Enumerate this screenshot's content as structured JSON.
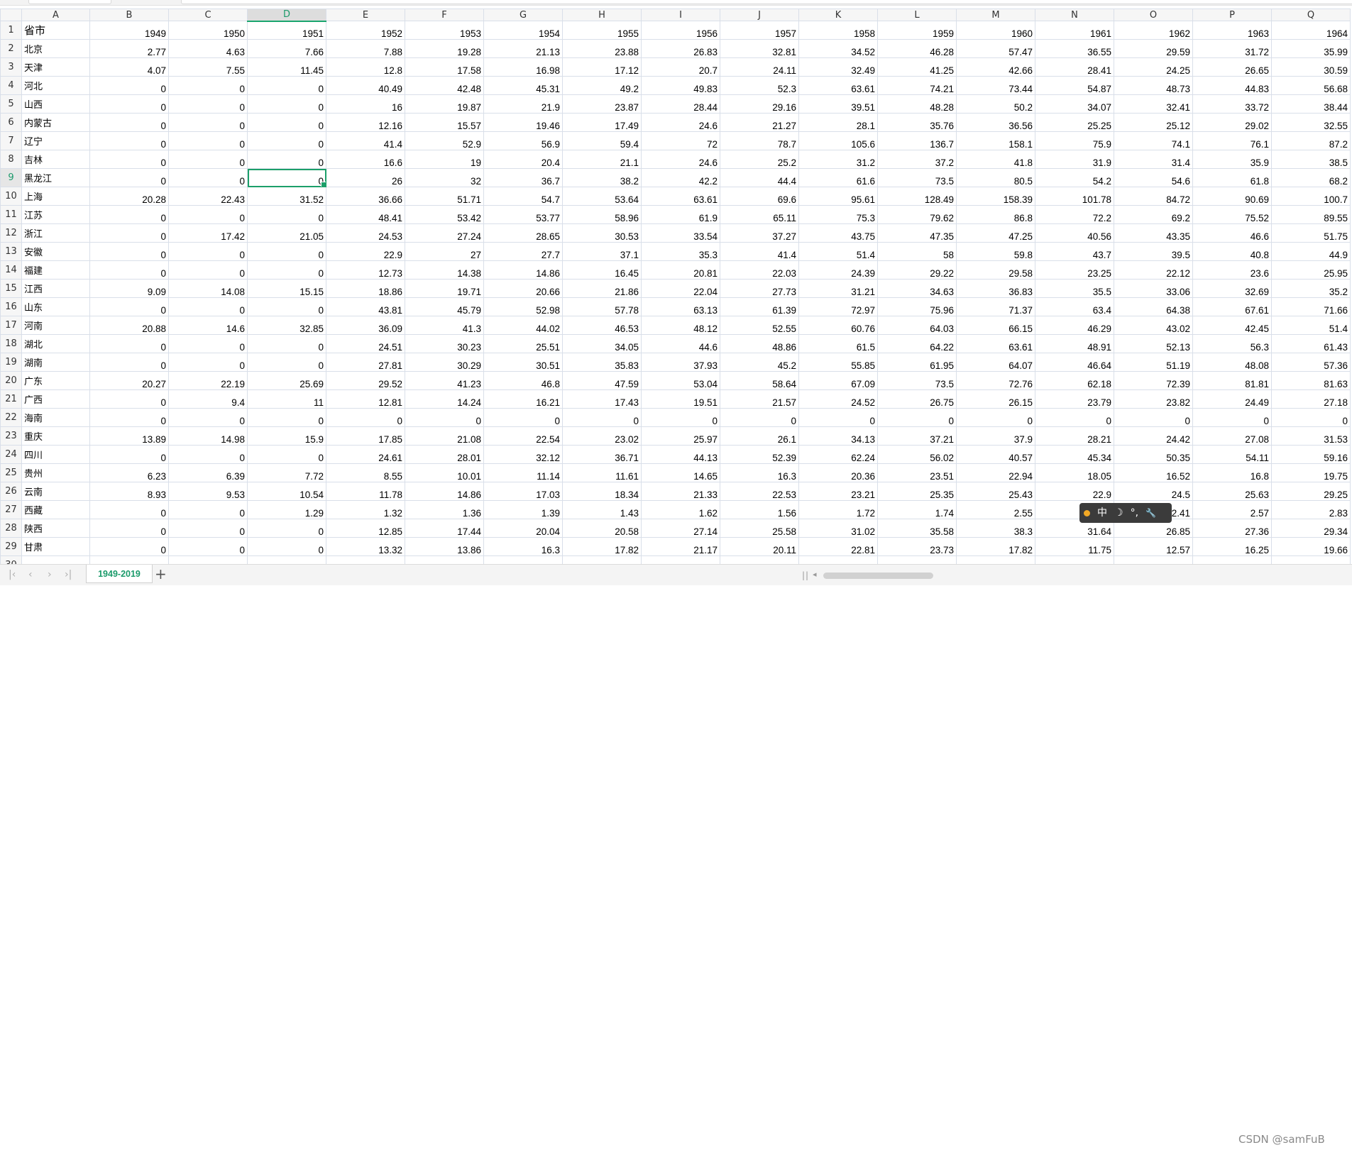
{
  "app": {
    "watermark": "CSDN @samFuB"
  },
  "ime_toolbar": {
    "mode_label": "中",
    "moon_icon": "☽",
    "punct_icon": "°,",
    "wrench_icon": "🔧"
  },
  "sheet_tabs": [
    {
      "label": "1949-2019",
      "active": true
    }
  ],
  "add_tab_label": "+",
  "selection": {
    "active_cell": "D9"
  },
  "columns": [
    "A",
    "B",
    "C",
    "D",
    "E",
    "F",
    "G",
    "H",
    "I",
    "J",
    "K",
    "L",
    "M",
    "N",
    "O",
    "P",
    "Q"
  ],
  "header_row": {
    "row_number": 1,
    "name": "省市",
    "years": [
      "1949",
      "1950",
      "1951",
      "1952",
      "1953",
      "1954",
      "1955",
      "1956",
      "1957",
      "1958",
      "1959",
      "1960",
      "1961",
      "1962",
      "1963",
      "1964"
    ]
  },
  "rows": [
    {
      "r": 2,
      "name": "北京",
      "v": [
        "2.77",
        "4.63",
        "7.66",
        "7.88",
        "19.28",
        "21.13",
        "23.88",
        "26.83",
        "32.81",
        "34.52",
        "46.28",
        "57.47",
        "36.55",
        "29.59",
        "31.72",
        "35.99"
      ]
    },
    {
      "r": 3,
      "name": "天津",
      "v": [
        "4.07",
        "7.55",
        "11.45",
        "12.8",
        "17.58",
        "16.98",
        "17.12",
        "20.7",
        "24.11",
        "32.49",
        "41.25",
        "42.66",
        "28.41",
        "24.25",
        "26.65",
        "30.59"
      ]
    },
    {
      "r": 4,
      "name": "河北",
      "v": [
        "0",
        "0",
        "0",
        "40.49",
        "42.48",
        "45.31",
        "49.2",
        "49.83",
        "52.3",
        "63.61",
        "74.21",
        "73.44",
        "54.87",
        "48.73",
        "44.83",
        "56.68"
      ]
    },
    {
      "r": 5,
      "name": "山西",
      "v": [
        "0",
        "0",
        "0",
        "16",
        "19.87",
        "21.9",
        "23.87",
        "28.44",
        "29.16",
        "39.51",
        "48.28",
        "50.2",
        "34.07",
        "32.41",
        "33.72",
        "38.44"
      ]
    },
    {
      "r": 6,
      "name": "内蒙古",
      "v": [
        "0",
        "0",
        "0",
        "12.16",
        "15.57",
        "19.46",
        "17.49",
        "24.6",
        "21.27",
        "28.1",
        "35.76",
        "36.56",
        "25.25",
        "25.12",
        "29.02",
        "32.55"
      ]
    },
    {
      "r": 7,
      "name": "辽宁",
      "v": [
        "0",
        "0",
        "0",
        "41.4",
        "52.9",
        "56.9",
        "59.4",
        "72",
        "78.7",
        "105.6",
        "136.7",
        "158.1",
        "75.9",
        "74.1",
        "76.1",
        "87.2"
      ]
    },
    {
      "r": 8,
      "name": "吉林",
      "v": [
        "0",
        "0",
        "0",
        "16.6",
        "19",
        "20.4",
        "21.1",
        "24.6",
        "25.2",
        "31.2",
        "37.2",
        "41.8",
        "31.9",
        "31.4",
        "35.9",
        "38.5"
      ]
    },
    {
      "r": 9,
      "name": "黑龙江",
      "v": [
        "0",
        "0",
        "0",
        "26",
        "32",
        "36.7",
        "38.2",
        "42.2",
        "44.4",
        "61.6",
        "73.5",
        "80.5",
        "54.2",
        "54.6",
        "61.8",
        "68.2"
      ]
    },
    {
      "r": 10,
      "name": "上海",
      "v": [
        "20.28",
        "22.43",
        "31.52",
        "36.66",
        "51.71",
        "54.7",
        "53.64",
        "63.61",
        "69.6",
        "95.61",
        "128.49",
        "158.39",
        "101.78",
        "84.72",
        "90.69",
        "100.7"
      ]
    },
    {
      "r": 11,
      "name": "江苏",
      "v": [
        "0",
        "0",
        "0",
        "48.41",
        "53.42",
        "53.77",
        "58.96",
        "61.9",
        "65.11",
        "75.3",
        "79.62",
        "86.8",
        "72.2",
        "69.2",
        "75.52",
        "89.55"
      ]
    },
    {
      "r": 12,
      "name": "浙江",
      "v": [
        "0",
        "17.42",
        "21.05",
        "24.53",
        "27.24",
        "28.65",
        "30.53",
        "33.54",
        "37.27",
        "43.75",
        "47.35",
        "47.25",
        "40.56",
        "43.35",
        "46.6",
        "51.75"
      ]
    },
    {
      "r": 13,
      "name": "安徽",
      "v": [
        "0",
        "0",
        "0",
        "22.9",
        "27",
        "27.7",
        "37.1",
        "35.3",
        "41.4",
        "51.4",
        "58",
        "59.8",
        "43.7",
        "39.5",
        "40.8",
        "44.9"
      ]
    },
    {
      "r": 14,
      "name": "福建",
      "v": [
        "0",
        "0",
        "0",
        "12.73",
        "14.38",
        "14.86",
        "16.45",
        "20.81",
        "22.03",
        "24.39",
        "29.22",
        "29.58",
        "23.25",
        "22.12",
        "23.6",
        "25.95"
      ]
    },
    {
      "r": 15,
      "name": "江西",
      "v": [
        "9.09",
        "14.08",
        "15.15",
        "18.86",
        "19.71",
        "20.66",
        "21.86",
        "22.04",
        "27.73",
        "31.21",
        "34.63",
        "36.83",
        "35.5",
        "33.06",
        "32.69",
        "35.2"
      ]
    },
    {
      "r": 16,
      "name": "山东",
      "v": [
        "0",
        "0",
        "0",
        "43.81",
        "45.79",
        "52.98",
        "57.78",
        "63.13",
        "61.39",
        "72.97",
        "75.96",
        "71.37",
        "63.4",
        "64.38",
        "67.61",
        "71.66"
      ]
    },
    {
      "r": 17,
      "name": "河南",
      "v": [
        "20.88",
        "14.6",
        "32.85",
        "36.09",
        "41.3",
        "44.02",
        "46.53",
        "48.12",
        "52.55",
        "60.76",
        "64.03",
        "66.15",
        "46.29",
        "43.02",
        "42.45",
        "51.4"
      ]
    },
    {
      "r": 18,
      "name": "湖北",
      "v": [
        "0",
        "0",
        "0",
        "24.51",
        "30.23",
        "25.51",
        "34.05",
        "44.6",
        "48.86",
        "61.5",
        "64.22",
        "63.61",
        "48.91",
        "52.13",
        "56.3",
        "61.43"
      ]
    },
    {
      "r": 19,
      "name": "湖南",
      "v": [
        "0",
        "0",
        "0",
        "27.81",
        "30.29",
        "30.51",
        "35.83",
        "37.93",
        "45.2",
        "55.85",
        "61.95",
        "64.07",
        "46.64",
        "51.19",
        "48.08",
        "57.36"
      ]
    },
    {
      "r": 20,
      "name": "广东",
      "v": [
        "20.27",
        "22.19",
        "25.69",
        "29.52",
        "41.23",
        "46.8",
        "47.59",
        "53.04",
        "58.64",
        "67.09",
        "73.5",
        "72.76",
        "62.18",
        "72.39",
        "81.81",
        "81.63"
      ]
    },
    {
      "r": 21,
      "name": "广西",
      "v": [
        "0",
        "9.4",
        "11",
        "12.81",
        "14.24",
        "16.21",
        "17.43",
        "19.51",
        "21.57",
        "24.52",
        "26.75",
        "26.15",
        "23.79",
        "23.82",
        "24.49",
        "27.18"
      ]
    },
    {
      "r": 22,
      "name": "海南",
      "v": [
        "0",
        "0",
        "0",
        "0",
        "0",
        "0",
        "0",
        "0",
        "0",
        "0",
        "0",
        "0",
        "0",
        "0",
        "0",
        "0"
      ]
    },
    {
      "r": 23,
      "name": "重庆",
      "v": [
        "13.89",
        "14.98",
        "15.9",
        "17.85",
        "21.08",
        "22.54",
        "23.02",
        "25.97",
        "26.1",
        "34.13",
        "37.21",
        "37.9",
        "28.21",
        "24.42",
        "27.08",
        "31.53"
      ]
    },
    {
      "r": 24,
      "name": "四川",
      "v": [
        "0",
        "0",
        "0",
        "24.61",
        "28.01",
        "32.12",
        "36.71",
        "44.13",
        "52.39",
        "62.24",
        "56.02",
        "40.57",
        "45.34",
        "50.35",
        "54.11",
        "59.16"
      ]
    },
    {
      "r": 25,
      "name": "贵州",
      "v": [
        "6.23",
        "6.39",
        "7.72",
        "8.55",
        "10.01",
        "11.14",
        "11.61",
        "14.65",
        "16.3",
        "20.36",
        "23.51",
        "22.94",
        "18.05",
        "16.52",
        "16.8",
        "19.75"
      ]
    },
    {
      "r": 26,
      "name": "云南",
      "v": [
        "8.93",
        "9.53",
        "10.54",
        "11.78",
        "14.86",
        "17.03",
        "18.34",
        "21.33",
        "22.53",
        "23.21",
        "25.35",
        "25.43",
        "22.9",
        "24.5",
        "25.63",
        "29.25"
      ]
    },
    {
      "r": 27,
      "name": "西藏",
      "v": [
        "0",
        "0",
        "1.29",
        "1.32",
        "1.36",
        "1.39",
        "1.43",
        "1.62",
        "1.56",
        "1.72",
        "1.74",
        "2.55",
        "",
        "2.41",
        "2.57",
        "2.83"
      ]
    },
    {
      "r": 28,
      "name": "陕西",
      "v": [
        "0",
        "0",
        "0",
        "12.85",
        "17.44",
        "20.04",
        "20.58",
        "27.14",
        "25.58",
        "31.02",
        "35.58",
        "38.3",
        "31.64",
        "26.85",
        "27.36",
        "29.34"
      ]
    },
    {
      "r": 29,
      "name": "甘肃",
      "v": [
        "0",
        "0",
        "0",
        "13.32",
        "13.86",
        "16.3",
        "17.82",
        "21.17",
        "20.11",
        "22.81",
        "23.73",
        "17.82",
        "11.75",
        "12.57",
        "16.25",
        "19.66"
      ]
    }
  ],
  "partial_row_number": "30"
}
